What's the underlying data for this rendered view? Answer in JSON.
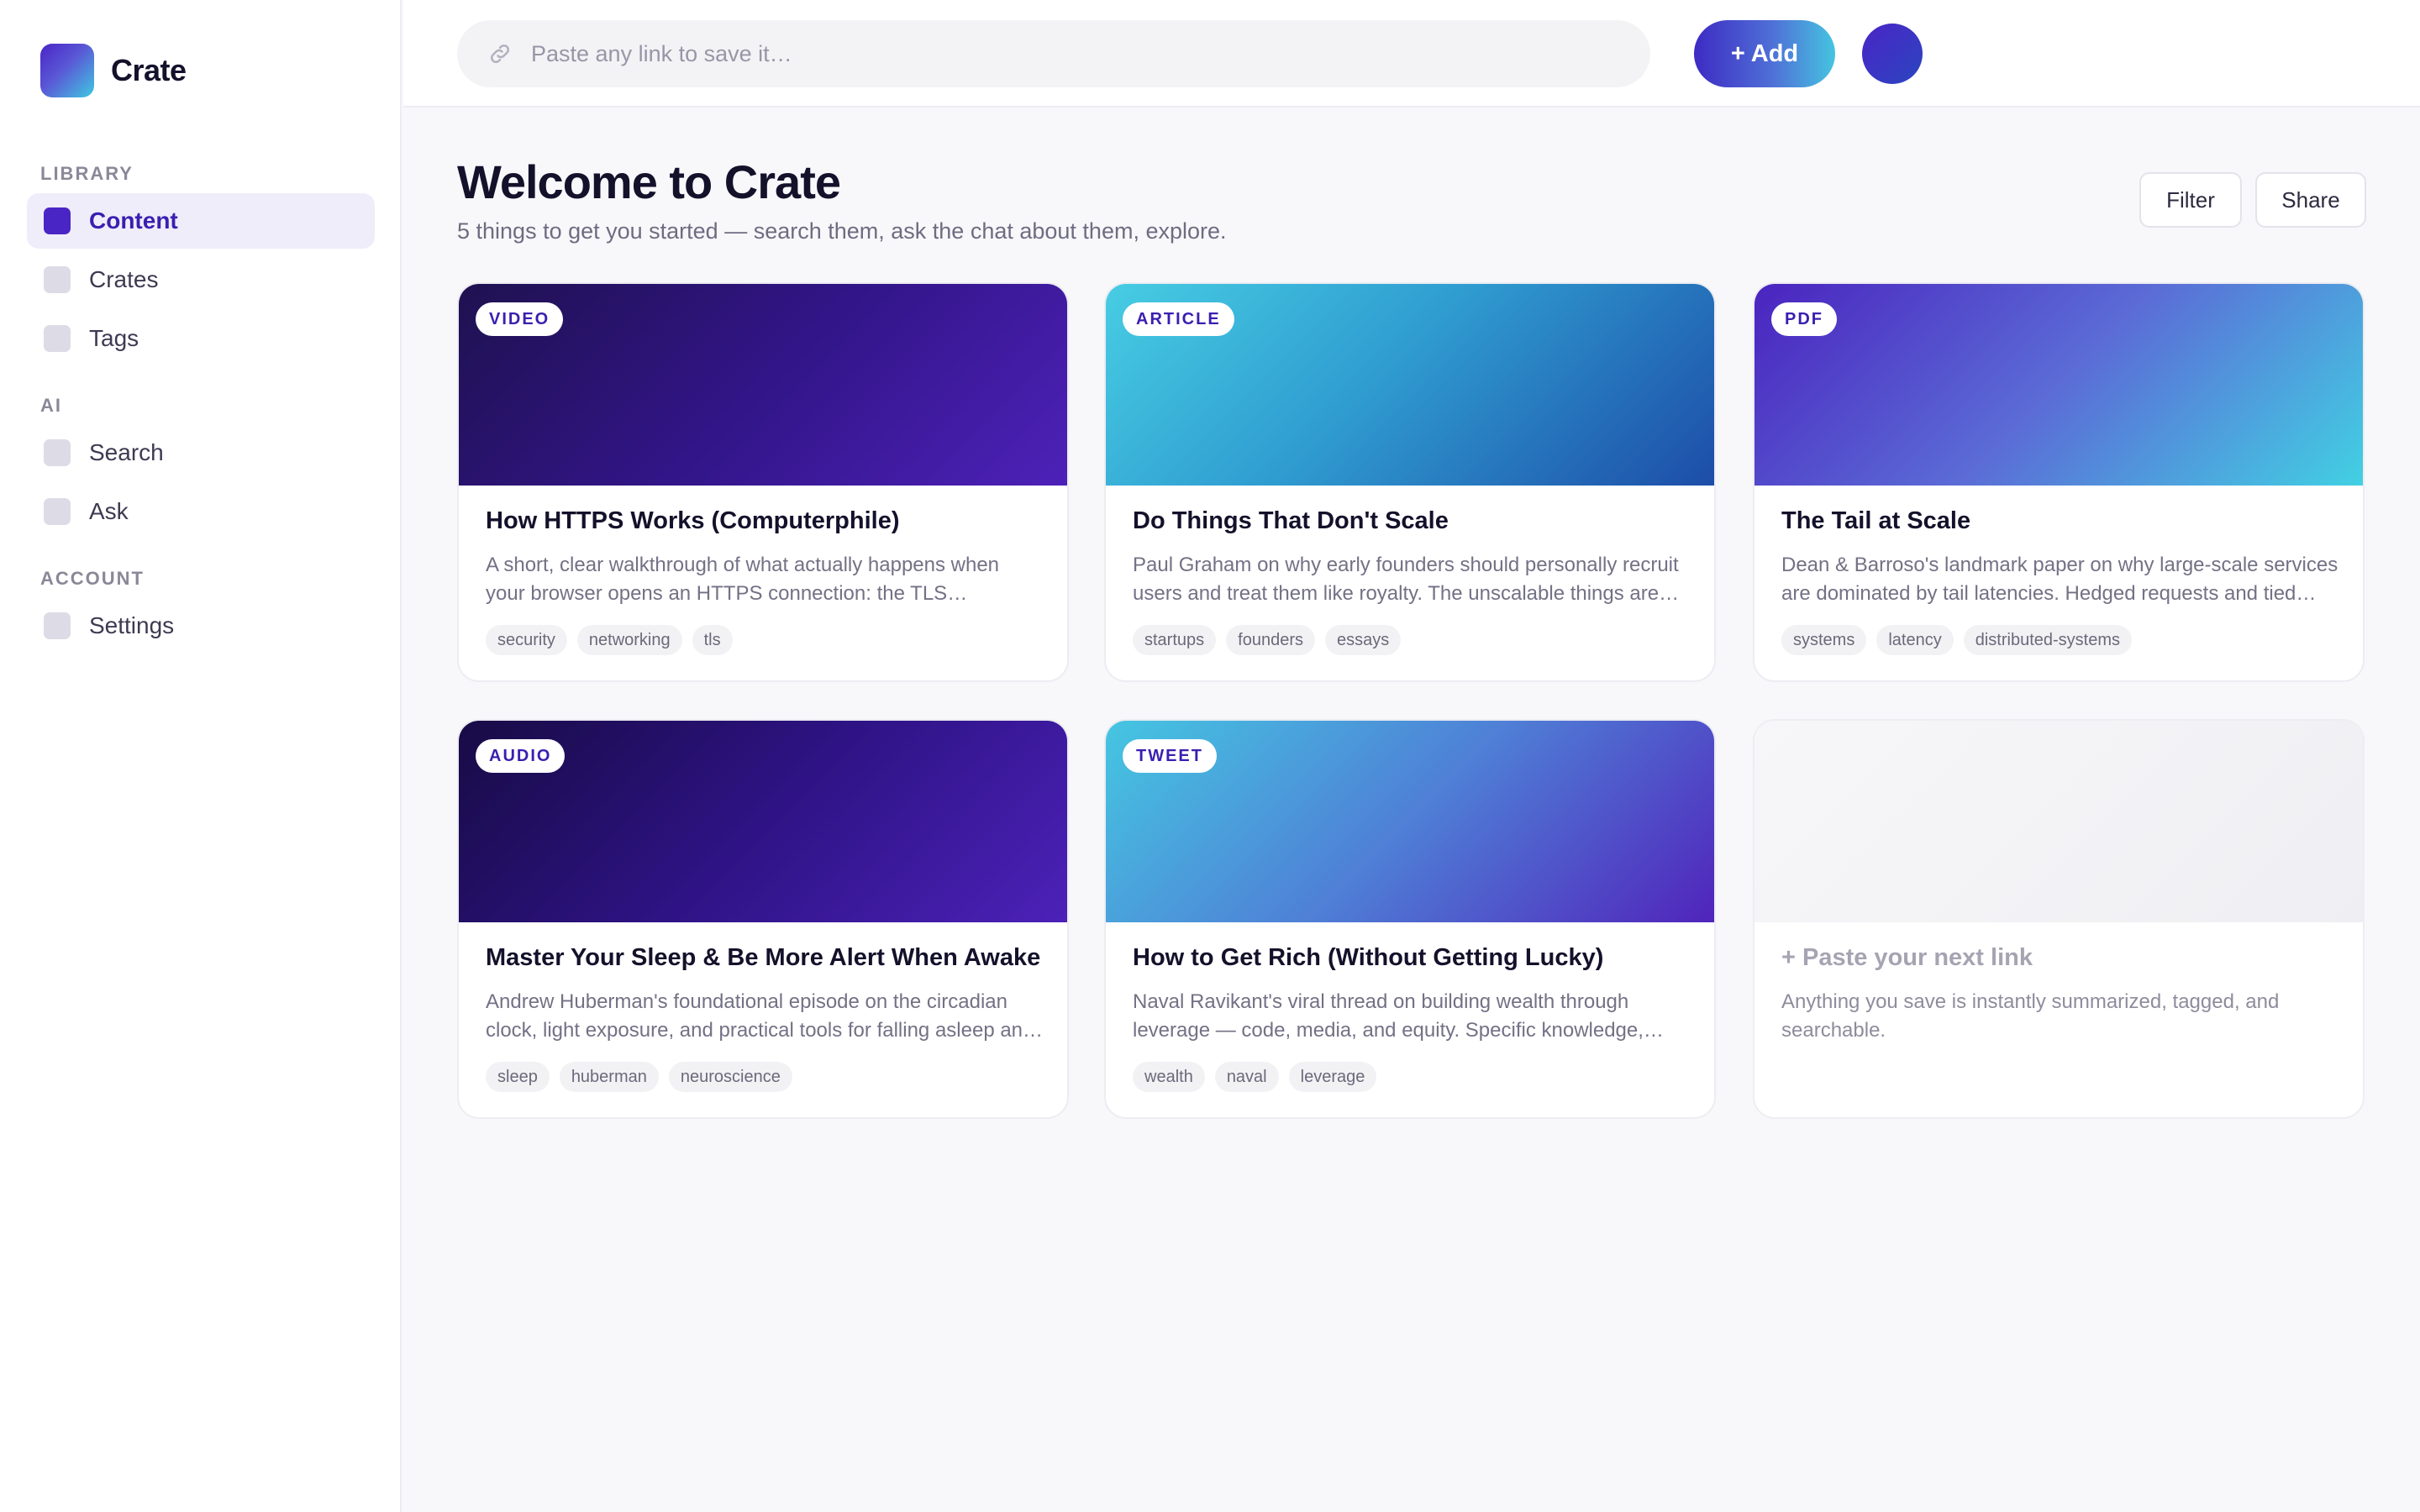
{
  "brand": {
    "name": "Crate"
  },
  "sidebar": {
    "sections": [
      {
        "label": "LIBRARY",
        "items": [
          {
            "label": "Content",
            "active": true
          },
          {
            "label": "Crates",
            "active": false
          },
          {
            "label": "Tags",
            "active": false
          }
        ]
      },
      {
        "label": "AI",
        "items": [
          {
            "label": "Search",
            "active": false
          },
          {
            "label": "Ask",
            "active": false
          }
        ]
      },
      {
        "label": "ACCOUNT",
        "items": [
          {
            "label": "Settings",
            "active": false
          }
        ]
      }
    ]
  },
  "topbar": {
    "link_placeholder": "Paste any link to save it…",
    "link_value": "",
    "add_label": "+ Add"
  },
  "header": {
    "title": "Welcome to Crate",
    "subtitle": "5 things to get you started — search them, ask the chat about them, explore.",
    "filter_label": "Filter",
    "share_label": "Share"
  },
  "cards": [
    {
      "type": "VIDEO",
      "title": "How HTTPS Works (Computerphile)",
      "description": "A short, clear walkthrough of what actually happens when your browser opens an HTTPS connection: the TLS handshake, certificates and keys.",
      "tags": [
        "security",
        "networking",
        "tls"
      ]
    },
    {
      "type": "ARTICLE",
      "title": "Do Things That Don't Scale",
      "description": "Paul Graham on why early founders should personally recruit users and treat them like royalty. The unscalable things are what make it work.",
      "tags": [
        "startups",
        "founders",
        "essays"
      ]
    },
    {
      "type": "PDF",
      "title": "The Tail at Scale",
      "description": "Dean & Barroso's landmark paper on why large-scale services are dominated by tail latencies. Hedged requests and tied requests explained.",
      "tags": [
        "systems",
        "latency",
        "distributed-systems"
      ]
    },
    {
      "type": "AUDIO",
      "title": "Master Your Sleep & Be More Alert When Awake",
      "description": "Andrew Huberman's foundational episode on the circadian clock, light exposure, and practical tools for falling asleep and staying asleep.",
      "tags": [
        "sleep",
        "huberman",
        "neuroscience"
      ]
    },
    {
      "type": "TWEET",
      "title": "How to Get Rich (Without Getting Lucky)",
      "description": "Naval Ravikant's viral thread on building wealth through leverage — code, media, and equity. Specific knowledge, accountability, judgment.",
      "tags": [
        "wealth",
        "naval",
        "leverage"
      ]
    }
  ],
  "placeholder_card": {
    "title": "+ Paste your next link",
    "description": "Anything you save is instantly summarized, tagged, and searchable."
  },
  "colors": {
    "accent": "#4a25c6",
    "accent_cyan": "#45c4e0",
    "text_primary": "#14112b",
    "text_muted": "#737185"
  },
  "icons": {
    "brand": "crate-logo-icon",
    "link": "link-icon",
    "nav": "nav-square-icon",
    "avatar": "avatar"
  }
}
